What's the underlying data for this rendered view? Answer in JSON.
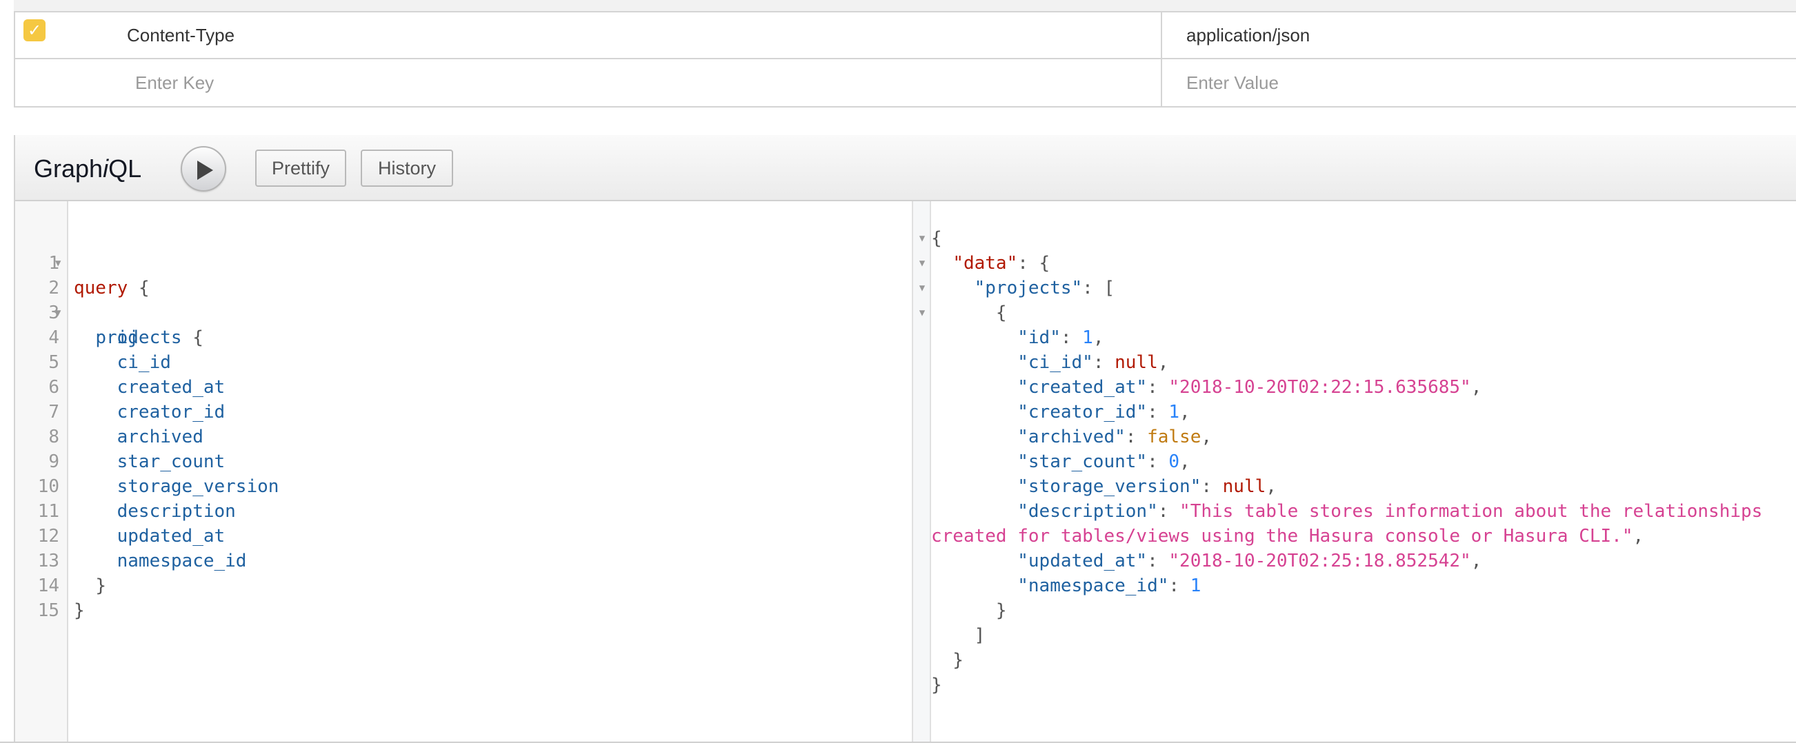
{
  "headers": {
    "rows": [
      {
        "checked": true,
        "key": "Content-Type",
        "value": "application/json"
      }
    ],
    "new_row": {
      "key_placeholder": "Enter Key",
      "value_placeholder": "Enter Value"
    }
  },
  "graphiql": {
    "logo_prefix": "Graph",
    "logo_italic": "i",
    "logo_suffix": "QL",
    "buttons": {
      "prettify": "Prettify",
      "history": "History"
    }
  },
  "query": {
    "line_numbers": [
      "1",
      "2",
      "3",
      "4",
      "5",
      "6",
      "7",
      "8",
      "9",
      "10",
      "11",
      "12",
      "13",
      "14",
      "15"
    ],
    "keyword": "query",
    "root_field": "projects",
    "fields": [
      "id",
      "ci_id",
      "created_at",
      "creator_id",
      "archived",
      "star_count",
      "storage_version",
      "description",
      "updated_at",
      "namespace_id"
    ],
    "open_brace": "{",
    "close_brace": "}"
  },
  "result": {
    "data_key": "\"data\"",
    "projects_key": "\"projects\"",
    "entries": [
      {
        "key": "\"id\"",
        "value": "1",
        "kind": "number"
      },
      {
        "key": "\"ci_id\"",
        "value": "null",
        "kind": "null"
      },
      {
        "key": "\"created_at\"",
        "value": "\"2018-10-20T02:22:15.635685\"",
        "kind": "string"
      },
      {
        "key": "\"creator_id\"",
        "value": "1",
        "kind": "number"
      },
      {
        "key": "\"archived\"",
        "value": "false",
        "kind": "bool"
      },
      {
        "key": "\"star_count\"",
        "value": "0",
        "kind": "number"
      },
      {
        "key": "\"storage_version\"",
        "value": "null",
        "kind": "null"
      },
      {
        "key": "\"description\"",
        "value": "\"This table stores information about the relationships",
        "kind": "string"
      },
      {
        "key": "",
        "value": "created for tables/views using the Hasura console or Hasura CLI.\"",
        "kind": "string-cont"
      },
      {
        "key": "\"updated_at\"",
        "value": "\"2018-10-20T02:25:18.852542\"",
        "kind": "string"
      },
      {
        "key": "\"namespace_id\"",
        "value": "1",
        "kind": "number-last"
      }
    ]
  }
}
